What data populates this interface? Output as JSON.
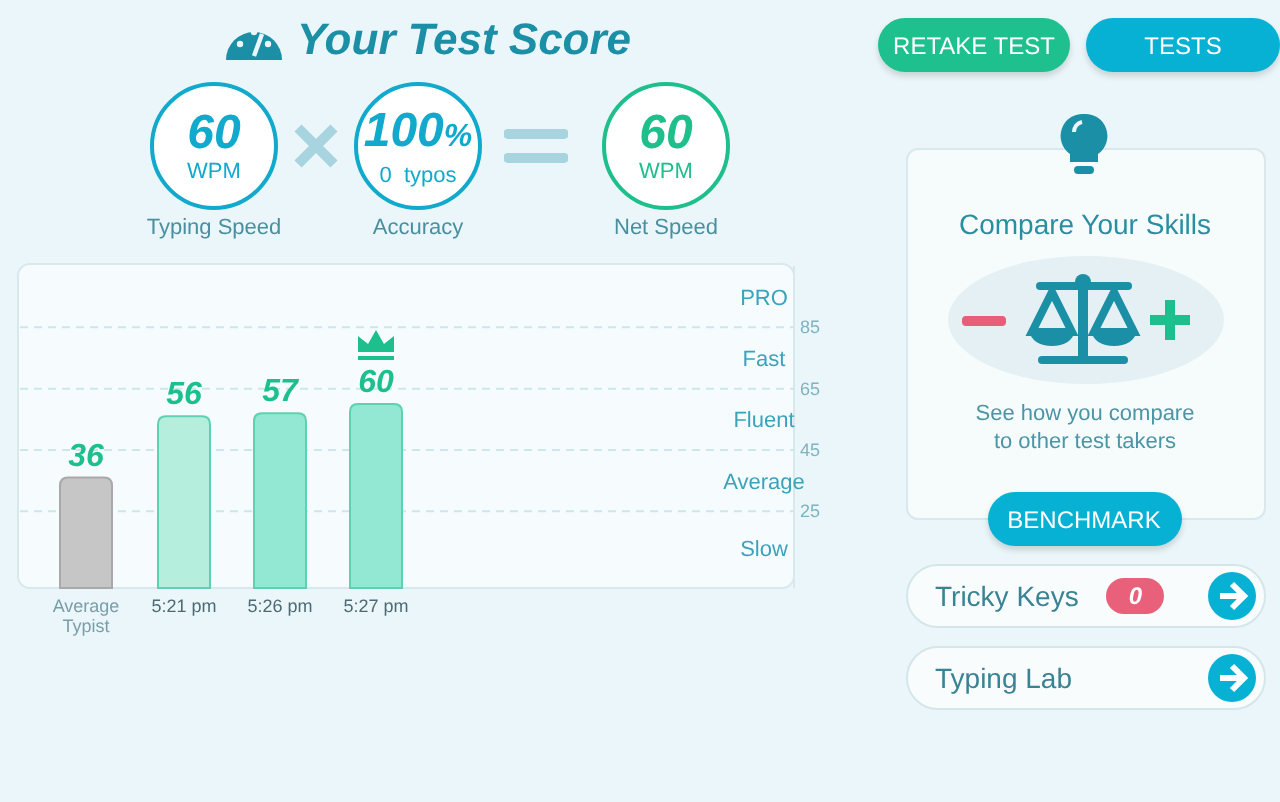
{
  "title": "Your Test Score",
  "scores": [
    {
      "kind": "speed",
      "value": "60",
      "unit": "WPM",
      "label": "Typing Speed"
    },
    {
      "kind": "accuracy",
      "value": "100",
      "suffix": "%",
      "unit": "0  typos",
      "label": "Accuracy"
    },
    {
      "kind": "net",
      "value": "60",
      "unit": "WPM",
      "label": "Net Speed"
    }
  ],
  "chart": {
    "chart_data": {
      "type": "bar",
      "categories": [
        "Average Typist",
        "5:21 pm",
        "5:26 pm",
        "5:27 pm"
      ],
      "values": [
        36,
        56,
        57,
        60
      ],
      "ylim": [
        0,
        105
      ],
      "data_labels": true,
      "annotations": [
        "PRO",
        "Fast",
        "Fluent",
        "Average",
        "Slow"
      ]
    },
    "scale_labels": [
      "85",
      "65",
      "45",
      "25"
    ],
    "bars": [
      {
        "color": "#c6c6c6",
        "crown": false
      },
      {
        "color": "#b5eedd",
        "crown": false
      },
      {
        "color": "#92e8d2",
        "crown": false
      },
      {
        "color": "#92e8d2",
        "crown": true
      }
    ]
  },
  "buttons": [
    {
      "kind": "green",
      "label": "RETAKE TEST"
    },
    {
      "kind": "blue",
      "label": "TESTS"
    }
  ],
  "compare": {
    "title": "Compare Your Skills",
    "text": "See how you compare to other test takers",
    "button": "BENCHMARK"
  },
  "links": [
    {
      "label": "Tricky Keys",
      "badge": "0"
    },
    {
      "label": "Typing Lab"
    }
  ]
}
